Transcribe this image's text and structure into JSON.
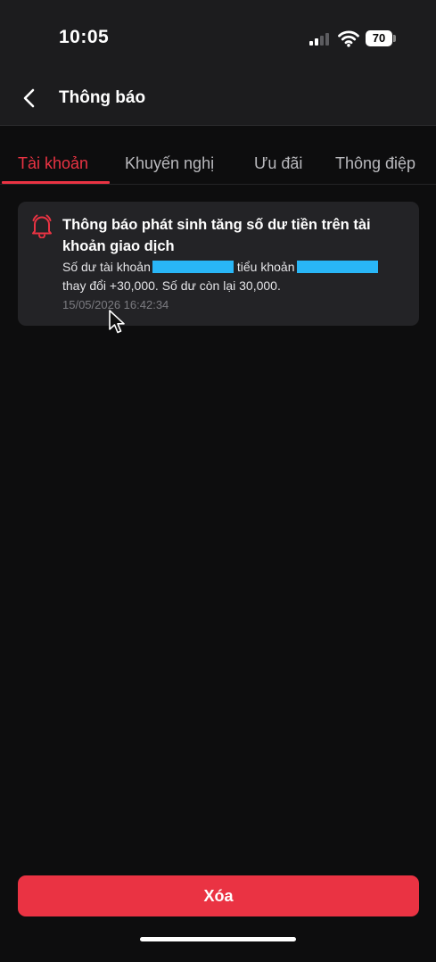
{
  "status_bar": {
    "time": "10:05",
    "battery": "70",
    "icons": [
      "signal-icon",
      "wifi-icon",
      "battery-icon"
    ]
  },
  "header": {
    "title": "Thông báo",
    "back_icon": "chevron-left-icon"
  },
  "tabs": [
    {
      "label": "Tài khoản",
      "active": true
    },
    {
      "label": "Khuyến nghị",
      "active": false
    },
    {
      "label": "Ưu đãi",
      "active": false
    },
    {
      "label": "Thông điệp",
      "active": false
    }
  ],
  "notifications": [
    {
      "icon": "bell-icon",
      "title": "Thông báo phát sinh tăng số dư tiền trên tài khoản giao dịch",
      "body_part1": "Số dư tài khoản",
      "body_part2": "tiểu khoản",
      "body_part3": "thay đổi +30,000. Số dư còn lại 30,000.",
      "timestamp": "15/05/2026 16:42:34"
    }
  ],
  "footer": {
    "delete_label": "Xóa"
  },
  "colors": {
    "accent": "#ea3343",
    "background": "#0d0d0e",
    "header_background": "#1c1c1e",
    "card_background": "#232326",
    "redaction": "#29b6f6",
    "tab_inactive": "#b9b9bd"
  }
}
